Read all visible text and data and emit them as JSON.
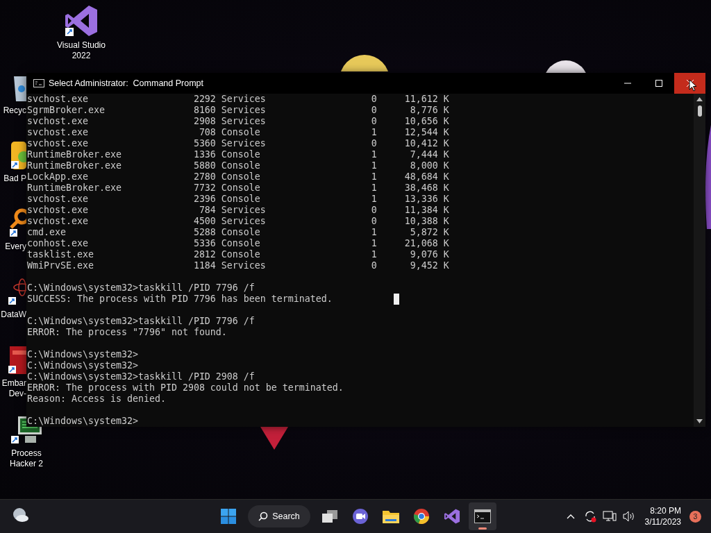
{
  "desktop_icons": [
    {
      "kind": "vs",
      "label": "Visual Studio\n2022",
      "cut": false
    },
    {
      "kind": "recycle",
      "label": "Recyc",
      "cut": true
    },
    {
      "kind": "game",
      "label": "Bad P",
      "cut": true
    },
    {
      "kind": "search",
      "label": "Every",
      "cut": true
    },
    {
      "kind": "atom",
      "label": "DataW",
      "cut": true
    },
    {
      "kind": "tile",
      "label": "Embar\nDev-",
      "cut": true
    },
    {
      "kind": "monitor",
      "label": "Process\nHacker 2",
      "cut": false
    }
  ],
  "window": {
    "title": "Select Administrator:  Command Prompt",
    "close_hovered": true
  },
  "console": {
    "processes": [
      {
        "name": "svchost.exe",
        "pid": "2292",
        "session": "Services",
        "session_num": "0",
        "mem": "11,612 K"
      },
      {
        "name": "SgrmBroker.exe",
        "pid": "8160",
        "session": "Services",
        "session_num": "0",
        "mem": "8,776 K"
      },
      {
        "name": "svchost.exe",
        "pid": "2908",
        "session": "Services",
        "session_num": "0",
        "mem": "10,656 K"
      },
      {
        "name": "svchost.exe",
        "pid": "708",
        "session": "Console",
        "session_num": "1",
        "mem": "12,544 K"
      },
      {
        "name": "svchost.exe",
        "pid": "5360",
        "session": "Services",
        "session_num": "0",
        "mem": "10,412 K"
      },
      {
        "name": "RuntimeBroker.exe",
        "pid": "1336",
        "session": "Console",
        "session_num": "1",
        "mem": "7,444 K"
      },
      {
        "name": "RuntimeBroker.exe",
        "pid": "5880",
        "session": "Console",
        "session_num": "1",
        "mem": "8,000 K"
      },
      {
        "name": "LockApp.exe",
        "pid": "2780",
        "session": "Console",
        "session_num": "1",
        "mem": "48,684 K"
      },
      {
        "name": "RuntimeBroker.exe",
        "pid": "7732",
        "session": "Console",
        "session_num": "1",
        "mem": "38,468 K"
      },
      {
        "name": "svchost.exe",
        "pid": "2396",
        "session": "Console",
        "session_num": "1",
        "mem": "13,336 K"
      },
      {
        "name": "svchost.exe",
        "pid": "784",
        "session": "Services",
        "session_num": "0",
        "mem": "11,384 K"
      },
      {
        "name": "svchost.exe",
        "pid": "4500",
        "session": "Services",
        "session_num": "0",
        "mem": "10,388 K"
      },
      {
        "name": "cmd.exe",
        "pid": "5288",
        "session": "Console",
        "session_num": "1",
        "mem": "5,872 K"
      },
      {
        "name": "conhost.exe",
        "pid": "5336",
        "session": "Console",
        "session_num": "1",
        "mem": "21,068 K"
      },
      {
        "name": "tasklist.exe",
        "pid": "2812",
        "session": "Console",
        "session_num": "1",
        "mem": "9,076 K"
      },
      {
        "name": "WmiPrvSE.exe",
        "pid": "1184",
        "session": "Services",
        "session_num": "0",
        "mem": "9,452 K"
      }
    ],
    "blocks": [
      [
        "C:\\Windows\\system32>taskkill /PID 7796 /f",
        "SUCCESS: The process with PID 7796 has been terminated."
      ],
      [
        "C:\\Windows\\system32>taskkill /PID 7796 /f",
        "ERROR: The process \"7796\" not found."
      ],
      [
        "C:\\Windows\\system32>",
        "C:\\Windows\\system32>",
        "C:\\Windows\\system32>taskkill /PID 2908 /f",
        "ERROR: The process with PID 2908 could not be terminated.",
        "Reason: Access is denied."
      ],
      [
        "C:\\Windows\\system32>"
      ]
    ]
  },
  "taskbar": {
    "search_label": "Search",
    "apps": [
      {
        "kind": "taskview",
        "selected": false
      },
      {
        "kind": "chat",
        "selected": false
      },
      {
        "kind": "folder",
        "selected": false
      },
      {
        "kind": "browser",
        "selected": false
      },
      {
        "kind": "vs",
        "selected": false
      },
      {
        "kind": "terminal",
        "selected": true
      }
    ],
    "time": "8:20 PM",
    "date": "3/11/2023",
    "notifications": "3"
  }
}
